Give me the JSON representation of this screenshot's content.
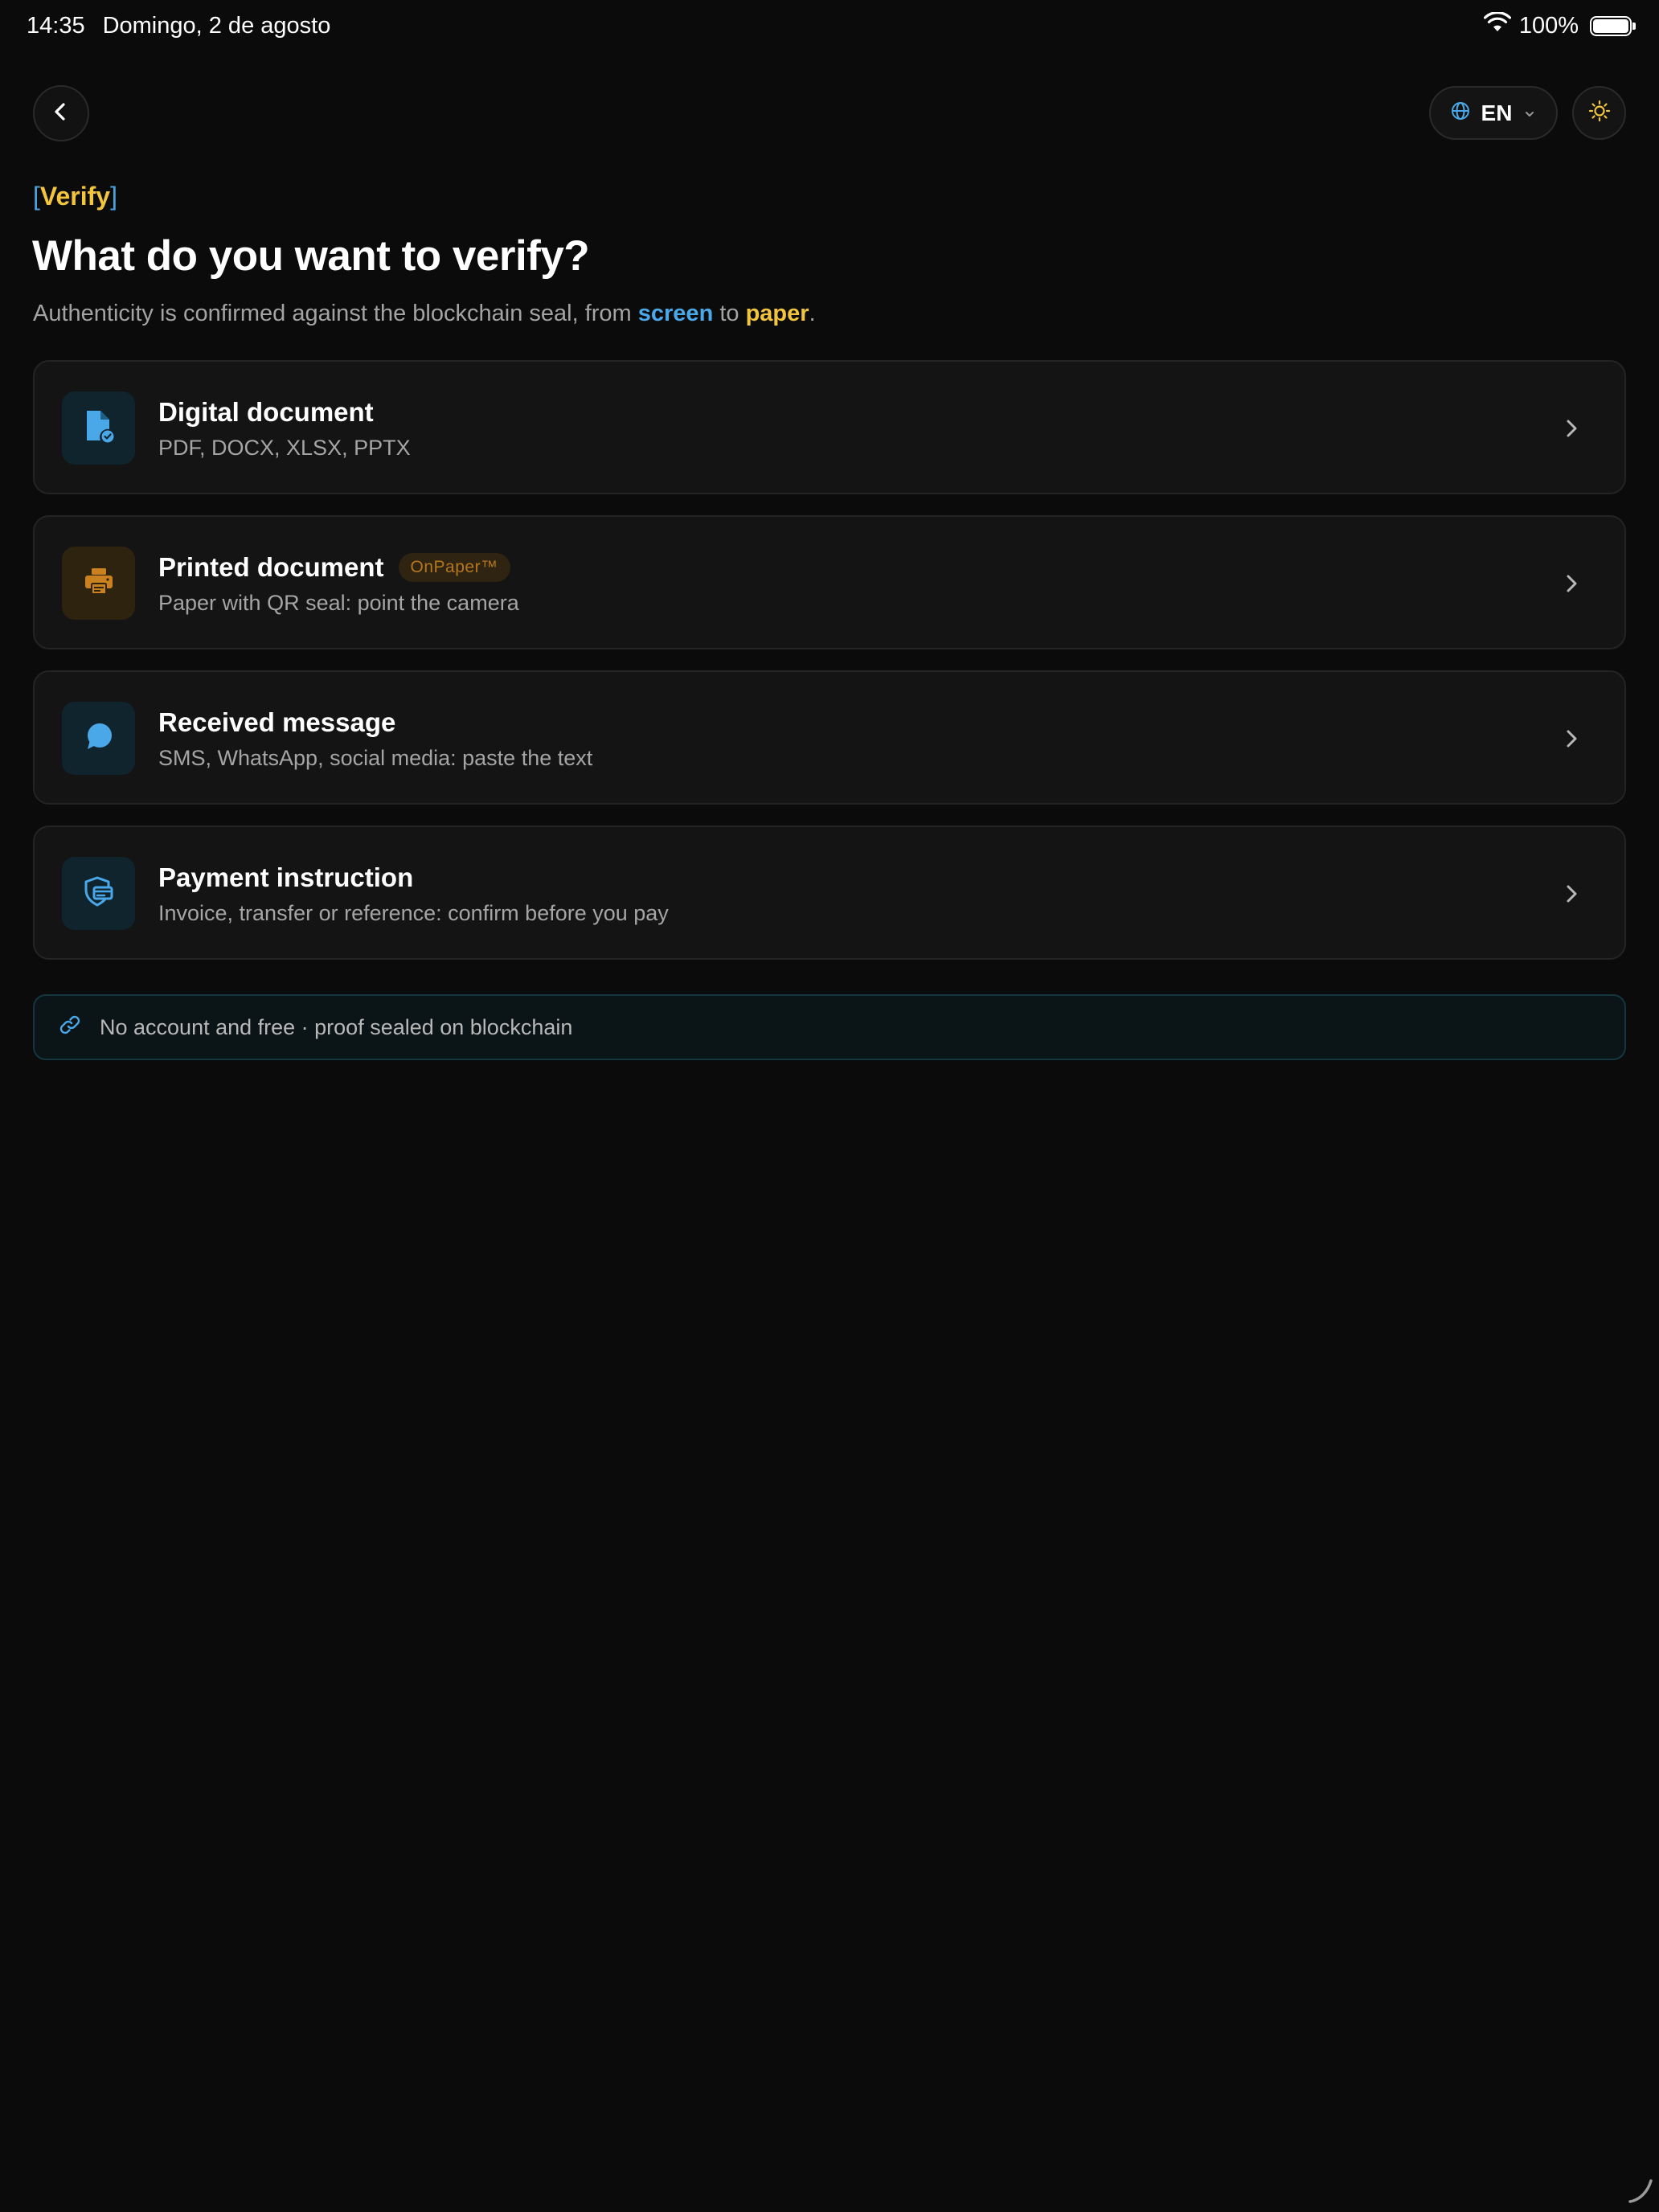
{
  "status_bar": {
    "time": "14:35",
    "date": "Domingo, 2 de agosto",
    "battery": "100%",
    "battery_level": 1.0
  },
  "nav": {
    "back_icon": "chevron-left-icon",
    "language": "EN",
    "language_icon": "globe-icon",
    "theme_icon": "sun-icon"
  },
  "header": {
    "eyebrow_open": "[",
    "eyebrow": "Verify",
    "eyebrow_close": "]",
    "title": "What do you want to verify?",
    "subtitle_prefix": "Authenticity is confirmed against the blockchain seal, from ",
    "subtitle_screen": "screen",
    "subtitle_middle": " to ",
    "subtitle_paper": "paper",
    "subtitle_end": "."
  },
  "options": [
    {
      "title": "Digital document",
      "subtitle": "PDF, DOCX, XLSX, PPTX",
      "icon": "file-check-icon",
      "accent": "#4aa8e8"
    },
    {
      "title": "Printed document",
      "badge": "OnPaper™",
      "subtitle": "Paper with QR seal: point the camera",
      "icon": "printer-icon",
      "accent": "#c9821f"
    },
    {
      "title": "Received message",
      "subtitle": "SMS, WhatsApp, social media: paste the text",
      "icon": "chat-bubble-icon",
      "accent": "#4aa8e8"
    },
    {
      "title": "Payment instruction",
      "subtitle": "Invoice, transfer or reference: confirm before you pay",
      "icon": "shield-card-icon",
      "accent": "#4aa8e8"
    }
  ],
  "info_banner": {
    "text": "No account and free · proof sealed on blockchain",
    "icon": "link-icon"
  },
  "colors": {
    "background": "#0b0b0b",
    "card": "#141414",
    "blue": "#4aa8e8",
    "yellow": "#f2c53d",
    "amber": "#c9821f"
  }
}
